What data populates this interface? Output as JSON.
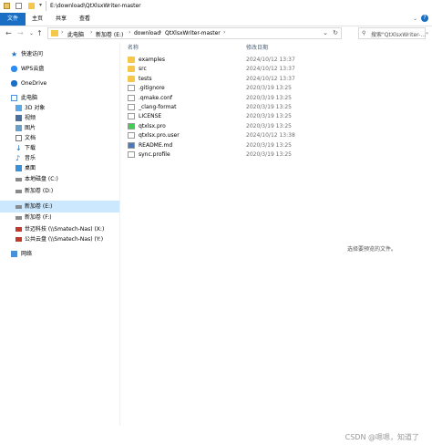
{
  "window": {
    "path_title": "E:\\download\\QtXlsxWriter-master"
  },
  "ribbon": {
    "tabs": [
      "文件",
      "主页",
      "共享",
      "查看"
    ]
  },
  "address": {
    "crumbs": [
      "此电脑",
      "新加卷 (E:)",
      "download",
      "QtXlsxWriter-master"
    ]
  },
  "search": {
    "placeholder": "搜索\"QtXlsxWriter-...\""
  },
  "sidebar": {
    "items": [
      {
        "label": "快速访问",
        "icon": "star-icon"
      },
      {
        "label": "WPS云盘",
        "icon": "cloud-icon"
      },
      {
        "label": "OneDrive",
        "icon": "onedrive-icon"
      },
      {
        "label": "此电脑",
        "icon": "computer-icon"
      },
      {
        "label": "3D 对象",
        "icon": "cube-icon"
      },
      {
        "label": "视频",
        "icon": "video-icon"
      },
      {
        "label": "图片",
        "icon": "picture-icon"
      },
      {
        "label": "文档",
        "icon": "document-icon"
      },
      {
        "label": "下载",
        "icon": "download-icon"
      },
      {
        "label": "音乐",
        "icon": "music-icon"
      },
      {
        "label": "桌面",
        "icon": "desktop-icon"
      },
      {
        "label": "本地磁盘 (C:)",
        "icon": "drive-icon"
      },
      {
        "label": "新加卷 (D:)",
        "icon": "drive-icon"
      },
      {
        "label": "新加卷 (E:)",
        "icon": "drive-icon"
      },
      {
        "label": "新加卷 (F:)",
        "icon": "drive-icon"
      },
      {
        "label": "世迈科技 (\\\\Smatech-Nas) (X:)",
        "icon": "network-drive-icon"
      },
      {
        "label": "公共云盘 (\\\\Smatech-Nas) (Y:)",
        "icon": "network-drive-icon"
      },
      {
        "label": "网络",
        "icon": "network-icon"
      }
    ]
  },
  "columns": {
    "name": "名称",
    "modified": "修改日期"
  },
  "files": [
    {
      "name": "examples",
      "date": "2024/10/12 13:37",
      "type": "folder"
    },
    {
      "name": "src",
      "date": "2024/10/12 13:37",
      "type": "folder"
    },
    {
      "name": "tests",
      "date": "2024/10/12 13:37",
      "type": "folder"
    },
    {
      "name": ".gitignore",
      "date": "2020/3/19 13:25",
      "type": "file"
    },
    {
      "name": ".qmake.conf",
      "date": "2020/3/19 13:25",
      "type": "file"
    },
    {
      "name": "_clang-format",
      "date": "2020/3/19 13:25",
      "type": "file"
    },
    {
      "name": "LICENSE",
      "date": "2020/3/19 13:25",
      "type": "file"
    },
    {
      "name": "qtxlsx.pro",
      "date": "2020/3/19 13:25",
      "type": "qt"
    },
    {
      "name": "qtxlsx.pro.user",
      "date": "2024/10/12 13:38",
      "type": "file"
    },
    {
      "name": "README.md",
      "date": "2020/3/19 13:25",
      "type": "md"
    },
    {
      "name": "sync.profile",
      "date": "2020/3/19 13:25",
      "type": "file"
    }
  ],
  "preview_text": "选择要预览的文件。",
  "watermark": "CSDN @嗯嗯，知道了",
  "colors": {
    "accent": "#1a6fc4",
    "selected": "#cce8ff",
    "folder": "#f5c84c"
  }
}
